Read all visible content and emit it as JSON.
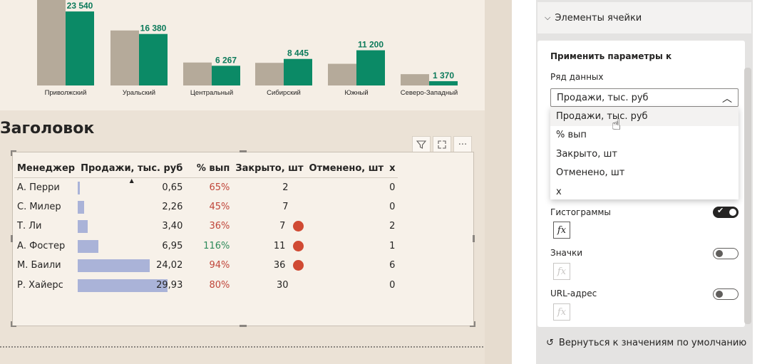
{
  "chart_data": {
    "type": "bar",
    "categories": [
      "Приволжский",
      "Уральский",
      "Центральный",
      "Сибирский",
      "Южный",
      "Северо-Западный"
    ],
    "series": [
      {
        "values": [
          28500,
          17500,
          7300,
          7200,
          6900,
          3600
        ]
      },
      {
        "values": [
          23540,
          16380,
          6267,
          8445,
          11200,
          1370
        ],
        "labels": [
          "23 540",
          "16 380",
          "6 267",
          "8 445",
          "11 200",
          "1 370"
        ]
      }
    ],
    "colors": [
      "#b5aa9a",
      "#0b8a66"
    ]
  },
  "visual": {
    "title": "Заголовок",
    "columns": [
      "Менеджер",
      "Продажи, тыс. руб",
      "% вып",
      "Закрыто, шт",
      "Отменено, шт",
      "x"
    ],
    "sort_arrow": "▲",
    "rows": [
      {
        "name": "А. Перри",
        "sales": "0,65",
        "sales_ratio": 0.022,
        "pct": "65%",
        "pct_status": "red",
        "closed": "2",
        "canceled_flag": false,
        "x": "0"
      },
      {
        "name": "С. Милер",
        "sales": "2,26",
        "sales_ratio": 0.075,
        "pct": "45%",
        "pct_status": "red",
        "closed": "7",
        "canceled_flag": false,
        "x": "0"
      },
      {
        "name": "Т. Ли",
        "sales": "3,40",
        "sales_ratio": 0.114,
        "pct": "36%",
        "pct_status": "red",
        "closed": "7",
        "canceled_flag": true,
        "x": "2"
      },
      {
        "name": "А. Фостер",
        "sales": "6,95",
        "sales_ratio": 0.232,
        "pct": "116%",
        "pct_status": "green",
        "closed": "11",
        "canceled_flag": true,
        "x": "1"
      },
      {
        "name": "М. Баили",
        "sales": "24,02",
        "sales_ratio": 0.802,
        "pct": "94%",
        "pct_status": "red",
        "closed": "36",
        "canceled_flag": true,
        "x": "6"
      },
      {
        "name": "Р. Хайерс",
        "sales": "29,93",
        "sales_ratio": 1.0,
        "pct": "80%",
        "pct_status": "red",
        "closed": "30",
        "canceled_flag": false,
        "x": "0"
      }
    ]
  },
  "pane": {
    "section_title": "Элементы ячейки",
    "apply_to_label": "Применить параметры к",
    "series_label": "Ряд данных",
    "series_selected": "Продажи, тыс. руб",
    "series_options": [
      "Продажи, тыс. руб",
      "% вып",
      "Закрыто, шт",
      "Отменено, шт",
      "x"
    ],
    "histograms_label": "Гистограммы",
    "histograms_on": true,
    "icons_label": "Значки",
    "icons_on": false,
    "url_label": "URL-адрес",
    "url_on": false,
    "fx_label": "fx",
    "reset_label": "Вернуться к значениям по умолчанию"
  }
}
